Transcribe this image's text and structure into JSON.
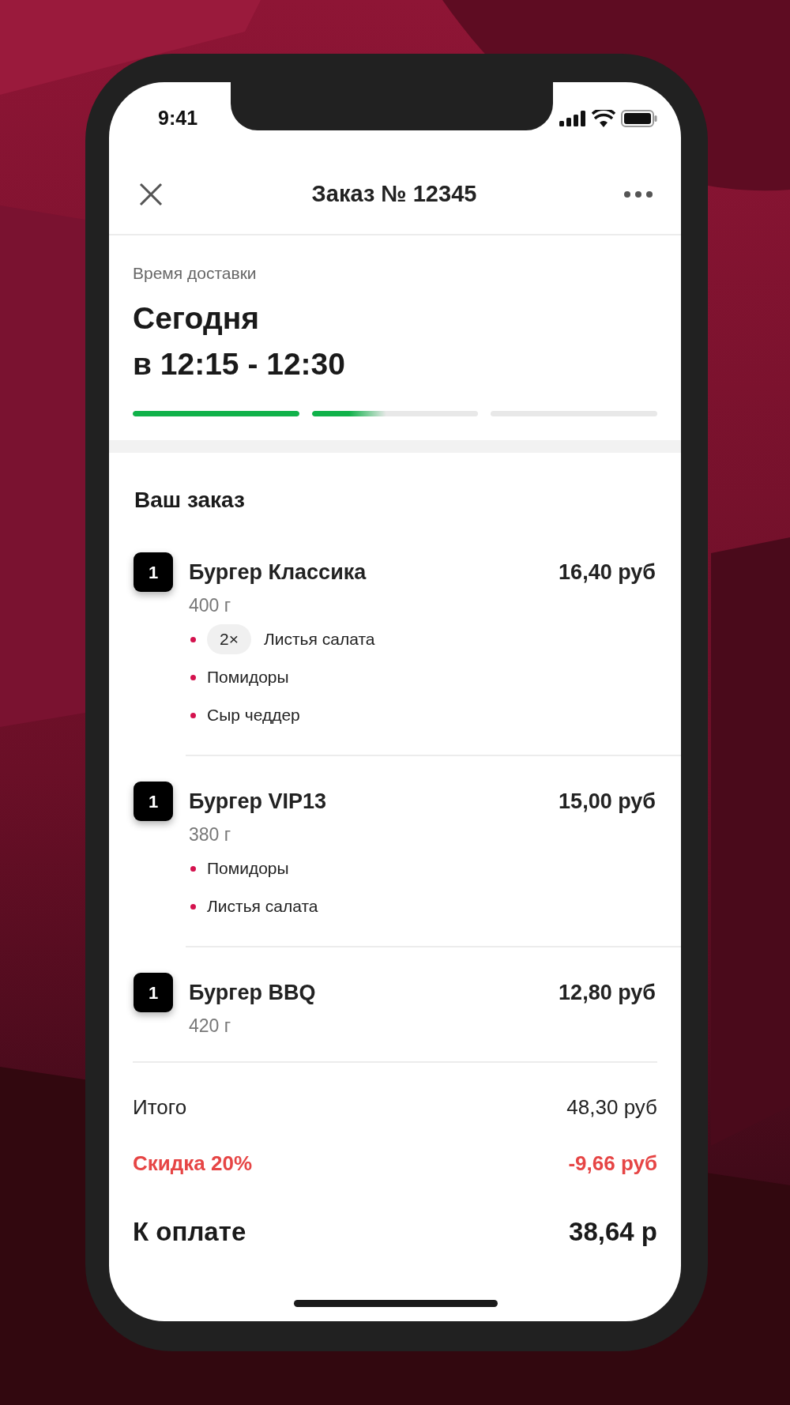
{
  "status_bar": {
    "time": "9:41"
  },
  "header": {
    "title": "Заказ № 12345"
  },
  "delivery": {
    "label": "Время доставки",
    "day": "Сегодня",
    "window": "в 12:15 - 12:30",
    "segments": [
      {
        "level": 1
      },
      {
        "level": 0.45
      },
      {
        "level": 0
      }
    ]
  },
  "order": {
    "title": "Ваш заказ",
    "items": [
      {
        "quantity": "1",
        "name": "Бургер Классика",
        "price": "16,40 руб",
        "weight": "400 г",
        "options": [
          {
            "quantity": "2×",
            "label": "Листья салата"
          },
          {
            "label": "Помидоры"
          },
          {
            "label": "Сыр чеддер"
          }
        ]
      },
      {
        "quantity": "1",
        "name": "Бургер VIP13",
        "price": "15,00 руб",
        "weight": "380 г",
        "options": [
          {
            "label": "Помидоры"
          },
          {
            "label": "Листья салата"
          }
        ]
      },
      {
        "quantity": "1",
        "name": "Бургер BBQ",
        "price": "12,80 руб",
        "weight": "420 г"
      }
    ]
  },
  "totals": [
    {
      "kind": "subtotal",
      "label": "Итого",
      "value": "48,30 руб"
    },
    {
      "kind": "discount",
      "label": "Скидка 20%",
      "value": "-9,66 руб"
    },
    {
      "kind": "total",
      "label": "К оплате",
      "value": "38,64 р"
    }
  ]
}
